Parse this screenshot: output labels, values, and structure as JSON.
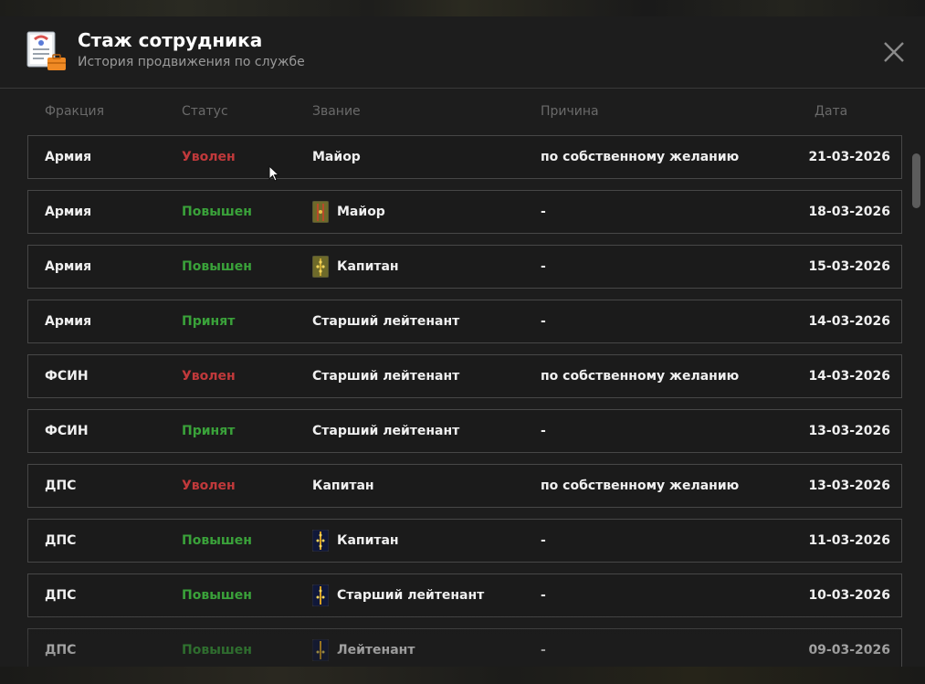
{
  "header": {
    "title": "Стаж сотрудника",
    "subtitle": "История продвижения по службе",
    "icon": "document-briefcase-icon",
    "close_icon": "close-icon"
  },
  "columns": [
    "Фракция",
    "Статус",
    "Звание",
    "Причина",
    "Дата"
  ],
  "colors": {
    "fired": "#c0393b",
    "promoted": "#3aa23a",
    "hired": "#3aa23a",
    "text": "#f0f0f0",
    "muted": "#6a6a6a"
  },
  "rows": [
    {
      "faction": "Армия",
      "status": "Уволен",
      "status_kind": "fired",
      "rank": "Майор",
      "insignia": "",
      "reason": "по собственному желанию",
      "date": "21-03-2026"
    },
    {
      "faction": "Армия",
      "status": "Повышен",
      "status_kind": "up",
      "rank": "Майор",
      "insignia": "army-major",
      "reason": "-",
      "date": "18-03-2026"
    },
    {
      "faction": "Армия",
      "status": "Повышен",
      "status_kind": "up",
      "rank": "Капитан",
      "insignia": "army-captain",
      "reason": "-",
      "date": "15-03-2026"
    },
    {
      "faction": "Армия",
      "status": "Принят",
      "status_kind": "hired",
      "rank": "Старший лейтенант",
      "insignia": "",
      "reason": "-",
      "date": "14-03-2026"
    },
    {
      "faction": "ФСИН",
      "status": "Уволен",
      "status_kind": "fired",
      "rank": "Старший лейтенант",
      "insignia": "",
      "reason": "по собственному желанию",
      "date": "14-03-2026"
    },
    {
      "faction": "ФСИН",
      "status": "Принят",
      "status_kind": "hired",
      "rank": "Старший лейтенант",
      "insignia": "",
      "reason": "-",
      "date": "13-03-2026"
    },
    {
      "faction": "ДПС",
      "status": "Уволен",
      "status_kind": "fired",
      "rank": "Капитан",
      "insignia": "",
      "reason": "по собственному желанию",
      "date": "13-03-2026"
    },
    {
      "faction": "ДПС",
      "status": "Повышен",
      "status_kind": "up",
      "rank": "Капитан",
      "insignia": "police-captain",
      "reason": "-",
      "date": "11-03-2026"
    },
    {
      "faction": "ДПС",
      "status": "Повышен",
      "status_kind": "up",
      "rank": "Старший лейтенант",
      "insignia": "police-senior-lieutenant",
      "reason": "-",
      "date": "10-03-2026"
    },
    {
      "faction": "ДПС",
      "status": "Повышен",
      "status_kind": "up",
      "rank": "Лейтенант",
      "insignia": "police-lieutenant",
      "reason": "-",
      "date": "09-03-2026"
    }
  ]
}
